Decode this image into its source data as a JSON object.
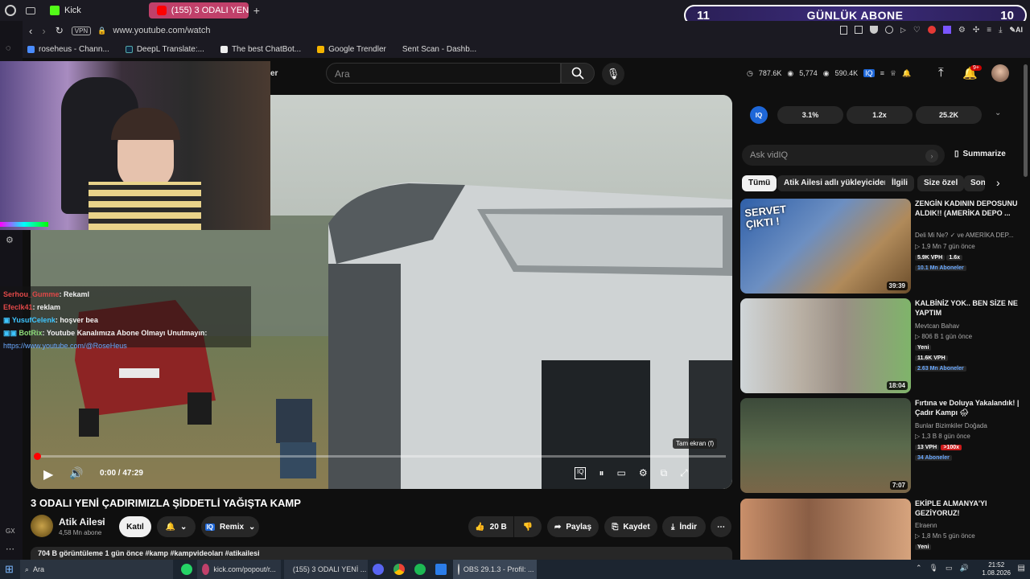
{
  "tabs": [
    {
      "label": "Kick",
      "active": false
    },
    {
      "label": "(155) 3 ODALI YENİ ÇADIR",
      "active": true
    }
  ],
  "address": {
    "vpn": "VPN",
    "url": "www.youtube.com/watch"
  },
  "bookmarks": [
    "roseheus - Chann...",
    "DeepL Translate:...",
    "The best ChatBot...",
    "Google Trendler",
    "Sent Scan - Dashb..."
  ],
  "overlay": {
    "left_num": "11",
    "label": "GÜNLÜK ABONE",
    "right_num": "10"
  },
  "youtube": {
    "partial_button": "er",
    "search_placeholder": "Ara",
    "notif_badge": "9+",
    "stats": {
      "a": "787.6K",
      "b": "5,774",
      "c": "590.4K"
    }
  },
  "chat": [
    {
      "user": "Serhou_Gumme",
      "msg": ": Rekaml",
      "color": "#e04848"
    },
    {
      "user": "Efeclk41",
      "msg": ": reklam",
      "color": "#e04848"
    },
    {
      "user": "YusufCelenk",
      "msg": ": hoşver bea",
      "color": "#3ec5ff"
    },
    {
      "user": "BotRix",
      "msg": ": Youtube Kanalımıza Abone Olmayı Unutmayın:",
      "color": "#8fe07a"
    },
    {
      "user": "",
      "msg": "https://www.youtube.com/@RoseHeus",
      "color": "#6aa9ff"
    }
  ],
  "player": {
    "time": "0:00 / 47:29",
    "fullscreen_tip": "Tam ekran (f)"
  },
  "video": {
    "title": "3 ODALI YENİ ÇADIRIMIZLA ŞİDDETLİ YAĞIŞTA KAMP",
    "channel": "Atik Ailesi",
    "subs": "4,58 Mn abone",
    "join": "Katıl",
    "remix": "Remix",
    "likes": "20 B",
    "share": "Paylaş",
    "save": "Kaydet",
    "download": "İndir",
    "desc": "704 B görüntüleme  1 gün önce  #kamp #kampvideoları #atikailesi"
  },
  "vidiq": {
    "v1": "3.1%",
    "v2": "1.2x",
    "v3": "25.2K",
    "ask": "Ask vidIQ",
    "summarize": "Summarize"
  },
  "chips": [
    "Tümü",
    "Atik Ailesi adlı yükleyiciden",
    "İlgili",
    "Size özel",
    "Son"
  ],
  "recs": [
    {
      "title": "ZENGİN KADININ DEPOSUNU ALDIK!! (AMERİKA DEPO ...",
      "channel": "Deli Mi Ne? ✓ ve AMERİKA DEP...",
      "meta": "▷ 1,9 Mn  7 gün önce",
      "vph": "5.9K VPH",
      "mult": "1.6x",
      "subs": "10.1 Mn Aboneler",
      "dur": "39:39",
      "thumb_text": "SERVET ÇIKTI !"
    },
    {
      "title": "KALBİNİZ YOK.. BEN SİZE NE YAPTIM",
      "channel": "Mevtcan Bahav",
      "meta": "▷ 806 B  1 gün önce",
      "badge": "Yeni",
      "vph": "11.6K VPH",
      "subs": "2.63 Mn Aboneler",
      "dur": "18:04"
    },
    {
      "title": "Fırtına ve Doluya Yakalandık! | Çadır Kampı 🌧",
      "channel": "Bunlar Bizimkiler Doğada",
      "meta": "▷ 1,3 B  8 gün önce",
      "vph": "13 VPH",
      "mult": ">100x",
      "subs": "34 Aboneler",
      "dur": "7:07"
    },
    {
      "title": "EKİPLE ALMANYA'YI GEZİYORUZ!",
      "channel": "Elraenn",
      "meta": "▷ 1,8 Mn  5 gün önce",
      "badge": "Yeni"
    }
  ],
  "taskbar": {
    "search": "Ara",
    "apps": [
      "kick.com/popout/r...",
      "(155) 3 ODALI YENİ ...",
      "OBS 29.1.3 - Profil: ..."
    ],
    "time": "21:52",
    "date": "1.08.2026"
  },
  "rail": {
    "gx": "GX"
  }
}
